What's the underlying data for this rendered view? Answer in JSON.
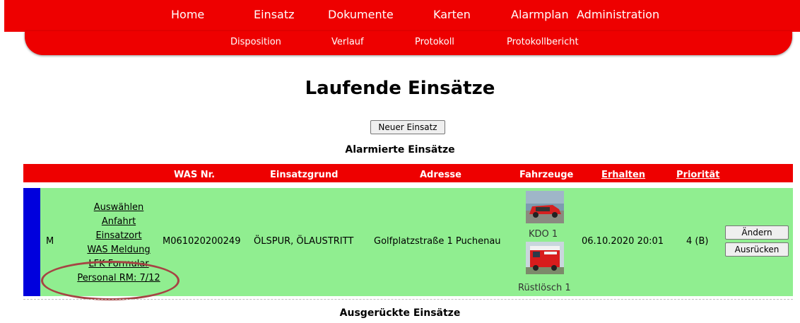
{
  "nav": {
    "main": [
      "Home",
      "Einsatz",
      "Dokumente",
      "Karten",
      "Alarmplan",
      "Administration"
    ],
    "sub": [
      "Disposition",
      "Verlauf",
      "Protokoll",
      "Protokollbericht"
    ]
  },
  "page": {
    "title": "Laufende Einsätze",
    "new_button": "Neuer Einsatz",
    "alarmed_title": "Alarmierte Einsätze",
    "dispatched_title": "Ausgerückte Einsätze"
  },
  "table": {
    "headers": {
      "was": "WAS Nr.",
      "grund": "Einsatzgrund",
      "adresse": "Adresse",
      "fahrzeuge": "Fahrzeuge",
      "erhalten": "Erhalten",
      "prioritaet": "Priorität"
    },
    "row": {
      "type": "M",
      "links": [
        "Auswählen",
        "Anfahrt",
        "Einsatzort",
        "WAS Meldung",
        "LFK Formular",
        "Personal RM: 7/12"
      ],
      "was": "M061020200249",
      "grund": "ÖLSPUR, ÖLAUSTRITT",
      "adresse": "Golfplatzstraße 1 Puchenau",
      "vehicles": [
        "KDO 1",
        "Rüstlösch 1"
      ],
      "erhalten": "06.10.2020 20:01",
      "prioritaet": "4 (B)",
      "btn_edit": "Ändern",
      "btn_dispatch": "Ausrücken"
    }
  },
  "colors": {
    "nav_red": "#ee0000",
    "row_green": "#90ee90",
    "marker_blue": "#0000dd",
    "annotation": "#a64444"
  }
}
